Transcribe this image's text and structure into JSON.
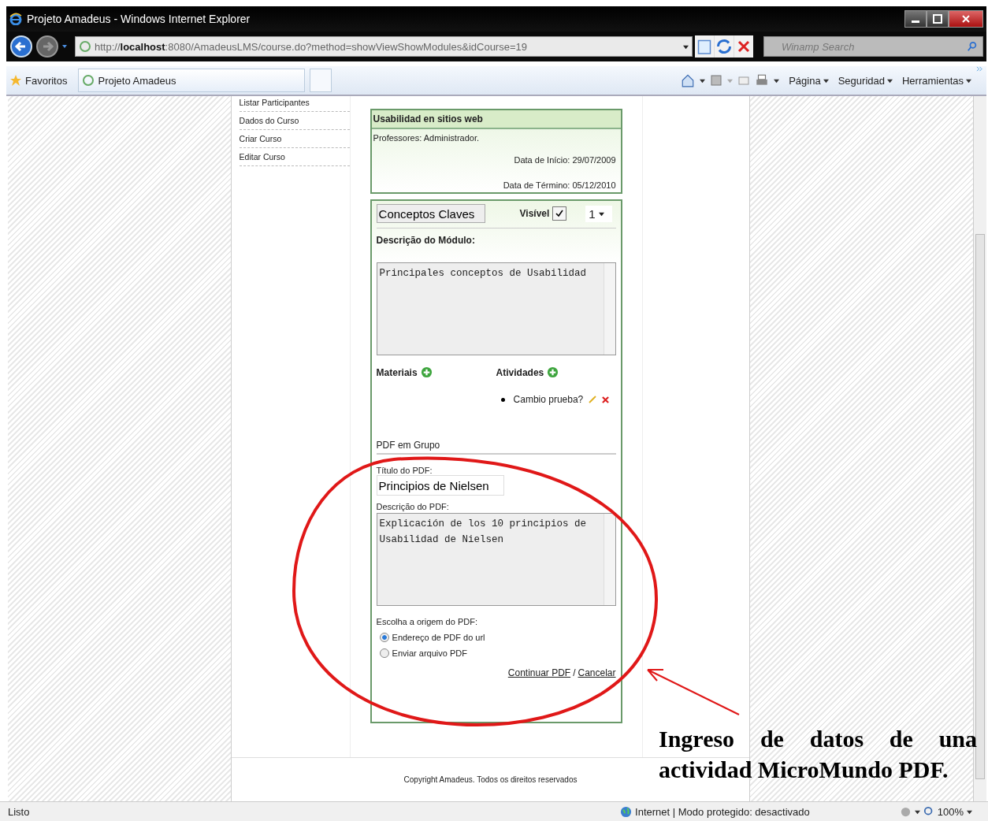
{
  "window": {
    "title": "Projeto Amadeus - Windows Internet Explorer"
  },
  "address_bar": {
    "url": "http://**localhost**:8080/AmadeusLMS/course.do?method=showViewShowModules&idCourse=19"
  },
  "search": {
    "placeholder": "Winamp Search"
  },
  "favorites": {
    "label": "Favoritos"
  },
  "tabs": [
    {
      "label": "Projeto Amadeus",
      "selected": true
    }
  ],
  "command_bar": [
    "Página",
    "Seguridad",
    "Herramientas"
  ],
  "sidebar": {
    "items": [
      "Listar Participantes",
      "Dados do Curso",
      "Criar Curso",
      "Editar Curso"
    ]
  },
  "course": {
    "title": "Usabilidad en sitios web",
    "professors": "Professores: Administrador.",
    "start": "Data de Início: 29/07/2009",
    "end": "Data de Término: 05/12/2010"
  },
  "module": {
    "name": "Conceptos Claves",
    "visible_label": "Visível",
    "visible": true,
    "order": "1",
    "description_label": "Descrição do Módulo:",
    "description": "Principales conceptos de Usabilidad",
    "materials_label": "Materiais",
    "activities_label": "Atividades",
    "activities": [
      "Cambio prueba?"
    ]
  },
  "pdf_form": {
    "heading": "PDF em Grupo",
    "title_label": "Título do PDF:",
    "title_value": "Principios de Nielsen",
    "description_label": "Descrição do PDF:",
    "description": "Explicación de los 10 principios de Usabilidad de Nielsen",
    "source_label": "Escolha a origem do PDF:",
    "sources": [
      {
        "label": "Endereço de PDF do url",
        "selected": true
      },
      {
        "label": "Enviar arquivo PDF",
        "selected": false
      }
    ],
    "continue_link": "Continuar PDF",
    "separator": "/",
    "cancel_link": "Cancelar"
  },
  "footer": {
    "copyright": "Copyright Amadeus. Todos os direitos reservados"
  },
  "annotation": {
    "text": "Ingreso de datos de una actividad MicroMundo PDF."
  },
  "status_bar": {
    "status": "Listo",
    "zone": "Internet | Modo protegido: desactivado",
    "zoom": "100%"
  }
}
